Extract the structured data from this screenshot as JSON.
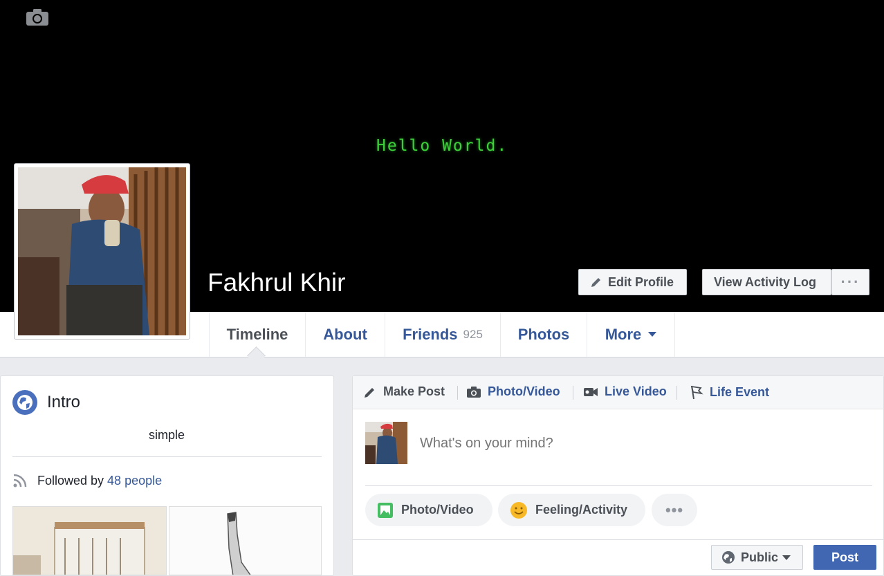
{
  "cover": {
    "text": "Hello World.",
    "text_color": "#3ed13b",
    "background": "#000000",
    "camera_icon": "camera-icon"
  },
  "profile": {
    "name": "Fakhrul Khir",
    "avatar_icon": "profile-photo"
  },
  "header_actions": {
    "edit_profile": "Edit Profile",
    "view_activity_log": "View Activity Log",
    "more": "···"
  },
  "nav": {
    "tabs": [
      {
        "label": "Timeline",
        "active": true
      },
      {
        "label": "About"
      },
      {
        "label": "Friends",
        "count": "925"
      },
      {
        "label": "Photos"
      },
      {
        "label": "More"
      }
    ]
  },
  "intro": {
    "title": "Intro",
    "bio": "simple",
    "followed_by_prefix": "Followed by",
    "followed_by_link": "48 people"
  },
  "composer": {
    "tabs": [
      "Make Post",
      "Photo/Video",
      "Live Video",
      "Life Event"
    ],
    "placeholder": "What's on your mind?",
    "actions": [
      "Photo/Video",
      "Feeling/Activity",
      "•••"
    ],
    "privacy": "Public",
    "post": "Post"
  },
  "colors": {
    "link": "#365899",
    "primary_button": "#4267b2",
    "page_bg": "#e9ebee"
  }
}
